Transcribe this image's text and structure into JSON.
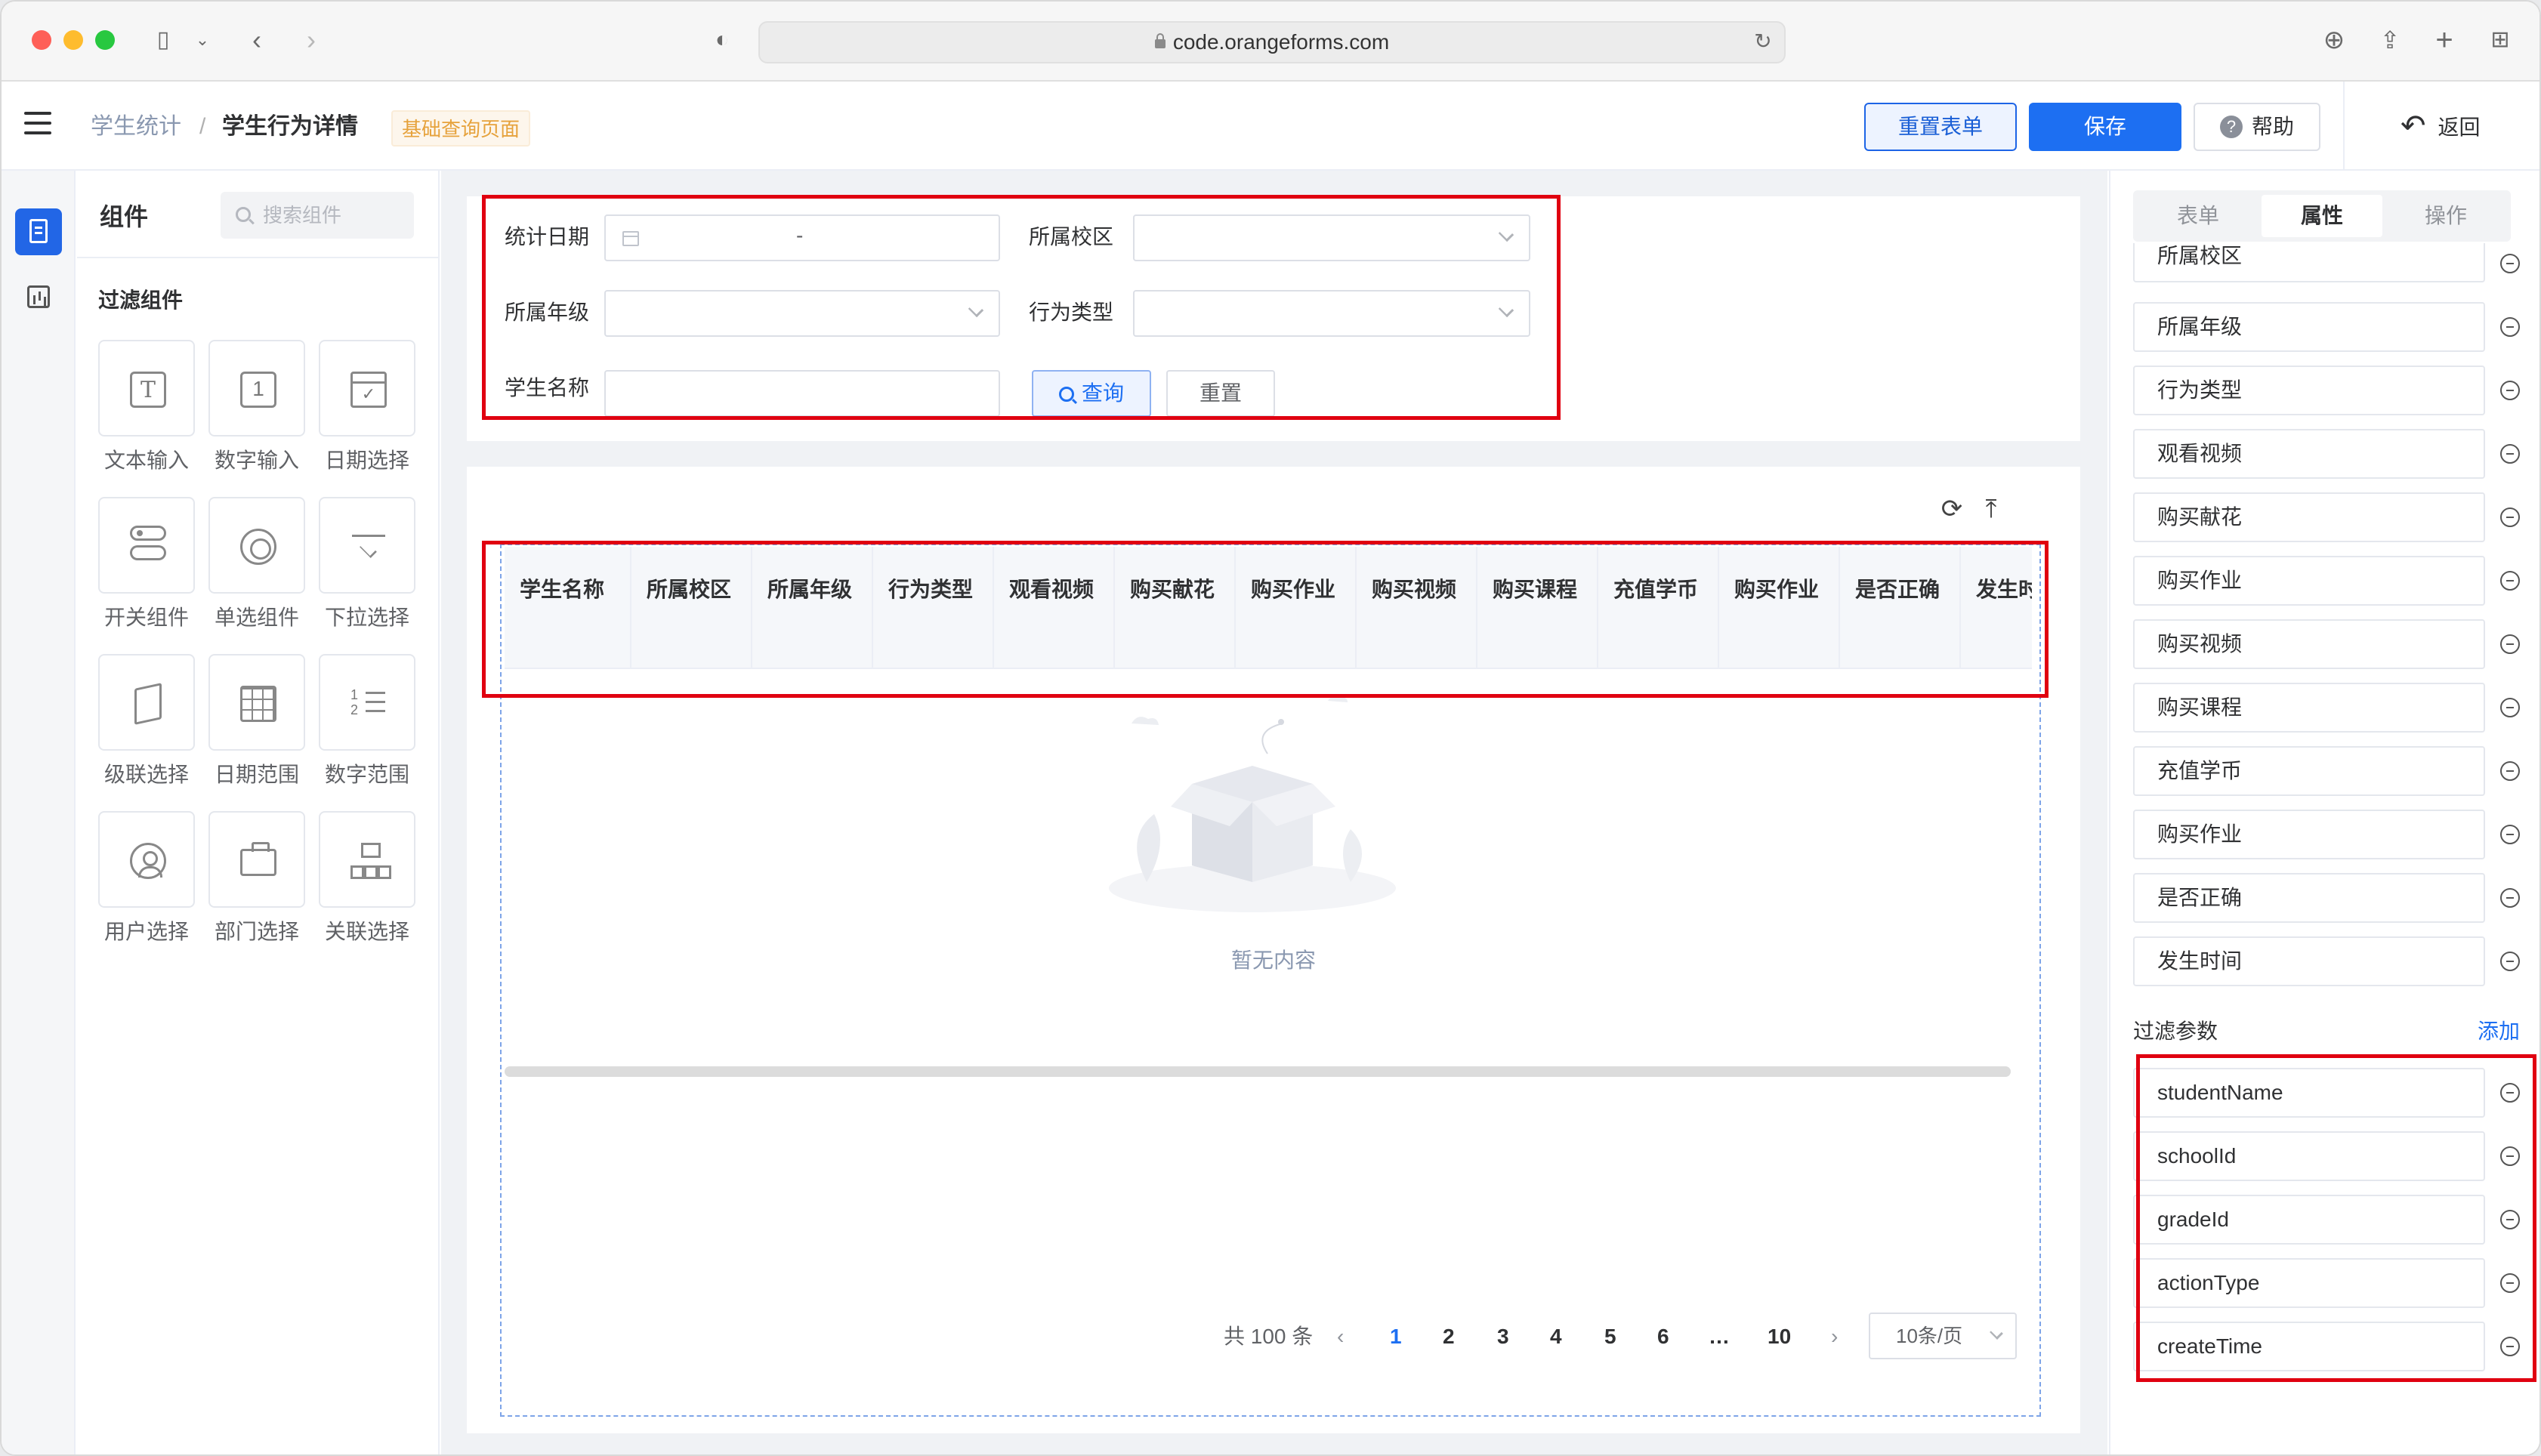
{
  "browser": {
    "url": "code.orangeforms.com"
  },
  "header": {
    "breadcrumb_parent": "学生统计",
    "breadcrumb_sep": "/",
    "breadcrumb_current": "学生行为详情",
    "page_tag": "基础查询页面",
    "reset_form_label": "重置表单",
    "save_label": "保存",
    "help_label": "帮助",
    "back_label": "返回",
    "help_glyph": "?",
    "back_glyph": "↶"
  },
  "component_panel": {
    "title": "组件",
    "search_placeholder": "搜索组件",
    "section_title": "过滤组件",
    "items": [
      {
        "label": "文本输入",
        "icon": "text-input-icon"
      },
      {
        "label": "数字输入",
        "icon": "number-input-icon"
      },
      {
        "label": "日期选择",
        "icon": "date-picker-icon"
      },
      {
        "label": "开关组件",
        "icon": "switch-icon"
      },
      {
        "label": "单选组件",
        "icon": "radio-icon"
      },
      {
        "label": "下拉选择",
        "icon": "dropdown-icon"
      },
      {
        "label": "级联选择",
        "icon": "cascader-icon"
      },
      {
        "label": "日期范围",
        "icon": "date-range-icon"
      },
      {
        "label": "数字范围",
        "icon": "number-range-icon"
      },
      {
        "label": "用户选择",
        "icon": "user-select-icon"
      },
      {
        "label": "部门选择",
        "icon": "department-select-icon"
      },
      {
        "label": "关联选择",
        "icon": "relation-select-icon"
      }
    ]
  },
  "filters": {
    "stat_date_label": "统计日期",
    "range_separator": "-",
    "school_label": "所属校区",
    "grade_label": "所属年级",
    "action_type_label": "行为类型",
    "student_name_label": "学生名称",
    "query_label": "查询",
    "reset_label": "重置"
  },
  "table": {
    "toolbar_refresh_glyph": "⟳",
    "toolbar_export_glyph": "⤒",
    "columns": [
      "学生名称",
      "所属校区",
      "所属年级",
      "行为类型",
      "观看视频",
      "购买献花",
      "购买作业",
      "购买视频",
      "购买课程",
      "充值学币",
      "购买作业",
      "是否正确",
      "发生时间"
    ],
    "empty_text": "暂无内容"
  },
  "pagination": {
    "total_text": "共 100 条",
    "prev_glyph": "‹",
    "next_glyph": "›",
    "pages": [
      "1",
      "2",
      "3",
      "4",
      "5",
      "6",
      "…",
      "10"
    ],
    "current_page": "1",
    "page_size": "10条/页"
  },
  "properties_panel": {
    "tabs": [
      "表单",
      "属性",
      "操作"
    ],
    "active_tab": "属性",
    "columns": [
      "所属校区",
      "所属年级",
      "行为类型",
      "观看视频",
      "购买献花",
      "购买作业",
      "购买视频",
      "购买课程",
      "充值学币",
      "购买作业",
      "是否正确",
      "发生时间"
    ],
    "filter_params_title": "过滤参数",
    "add_label": "添加",
    "filter_params": [
      "studentName",
      "schoolId",
      "gradeId",
      "actionType",
      "createTime"
    ]
  },
  "colors": {
    "primary": "#1d6ff2",
    "highlight_red": "#e00010",
    "tag_orange": "#e6a23c"
  }
}
